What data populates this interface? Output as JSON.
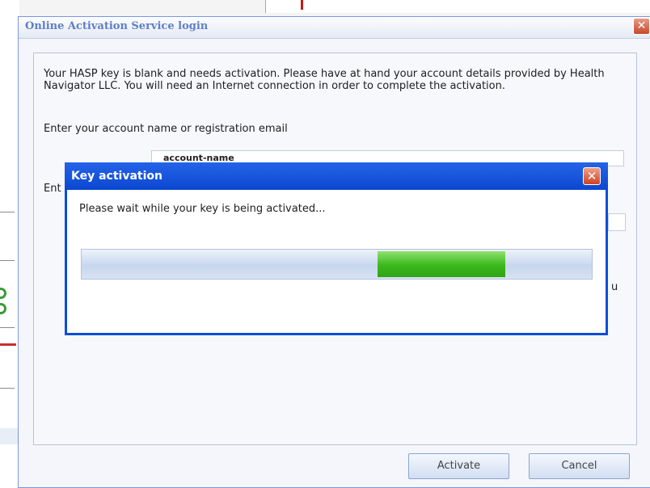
{
  "main_dialog": {
    "title": "Online Activation Service login",
    "close_symbol": "✕",
    "intro": "Your HASP key is blank and needs activation. Please have at hand your account details provided by Health Navigator LLC. You will need an Internet connection in order to complete the activation.",
    "account_label": "Enter your account name or registration email",
    "account_value": "account-name",
    "second_label_visible": "Ent",
    "third_label_visible": "u",
    "activate_label": "Activate",
    "cancel_label": "Cancel"
  },
  "modal": {
    "title": "Key activation",
    "close_symbol": "✕",
    "message": "Please wait while your key is being activated...",
    "progress_indeterminate_chunk": {
      "start": 0.58,
      "end": 0.83
    }
  },
  "colors": {
    "modal_titlebar": "#0b48d0",
    "progress_fill": "#3ab81c",
    "main_title_text": "#5d7fc6"
  },
  "icons": [
    "close-icon"
  ]
}
